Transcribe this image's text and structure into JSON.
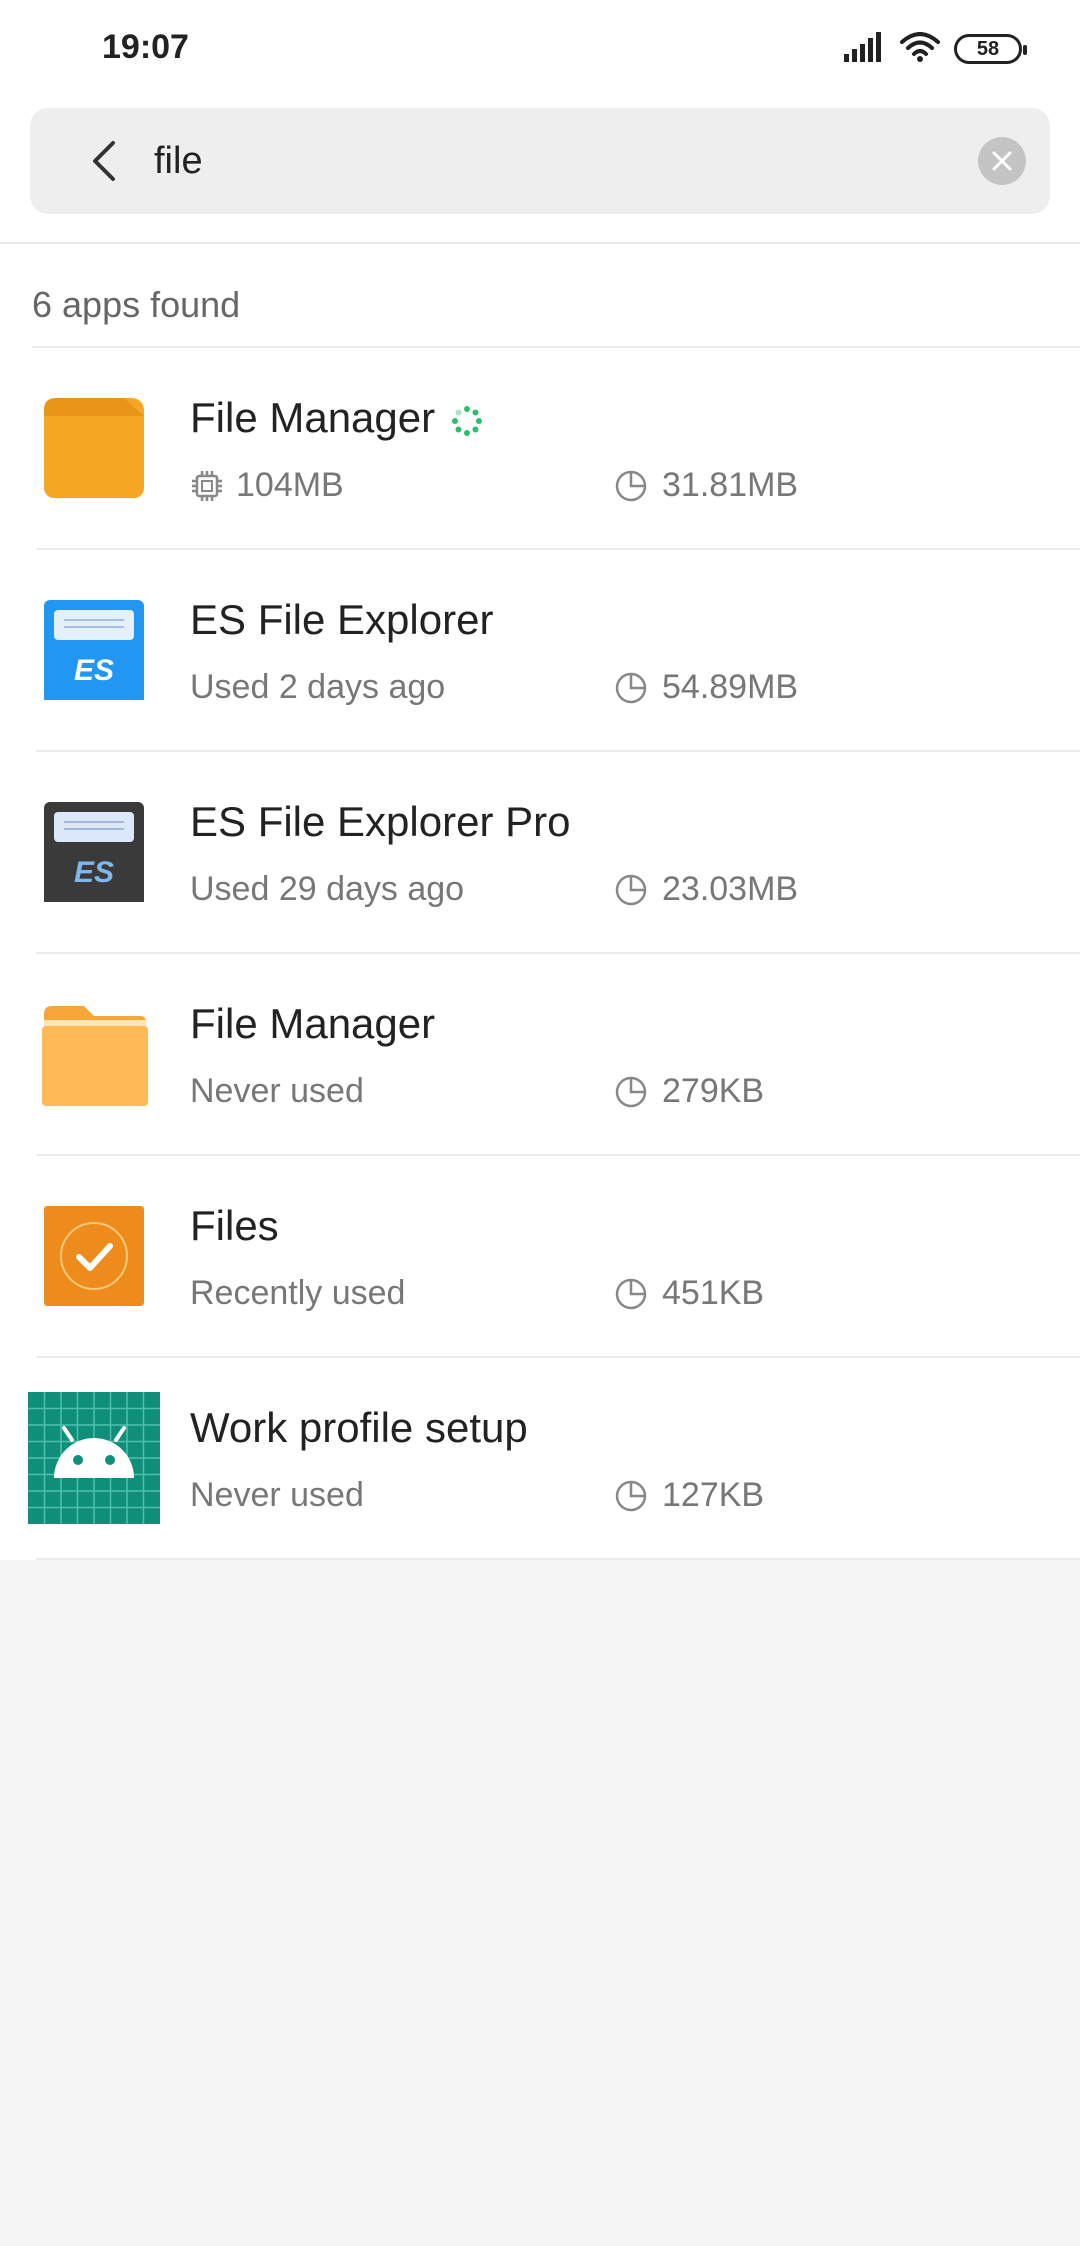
{
  "status_bar": {
    "time": "19:07",
    "battery_level": "58",
    "icons": [
      "signal-icon",
      "wifi-icon",
      "battery-icon"
    ]
  },
  "search": {
    "query": "file",
    "back_icon": "chevron-left-icon",
    "clear_icon": "clear-icon"
  },
  "results": {
    "count_text": "6 apps found",
    "apps": [
      {
        "name": "File Manager",
        "running": true,
        "left_icon": "chip-icon",
        "left_text": "104MB",
        "size": "31.81MB",
        "icon": "folder-orange-icon"
      },
      {
        "name": "ES File Explorer",
        "left_text": "Used 2 days ago",
        "size": "54.89MB",
        "icon": "es-file-explorer-icon",
        "icon_label": "ES"
      },
      {
        "name": "ES File Explorer Pro",
        "left_text": "Used 29 days ago",
        "size": "23.03MB",
        "icon": "es-file-explorer-pro-icon",
        "icon_label": "ES"
      },
      {
        "name": "File Manager",
        "left_text": "Never used",
        "size": "279KB",
        "icon": "folder-light-orange-icon"
      },
      {
        "name": "Files",
        "left_text": "Recently used",
        "size": "451KB",
        "icon": "files-check-icon"
      },
      {
        "name": "Work profile setup",
        "left_text": "Never used",
        "size": "127KB",
        "icon": "android-work-profile-icon"
      }
    ]
  },
  "colors": {
    "accent": "#1e88e5",
    "running_indicator": "#2bbf6a",
    "folder_orange": "#f5a623",
    "es_blue": "#2196f3",
    "es_dark": "#3a3a3a",
    "android_teal": "#0f8f7a"
  }
}
